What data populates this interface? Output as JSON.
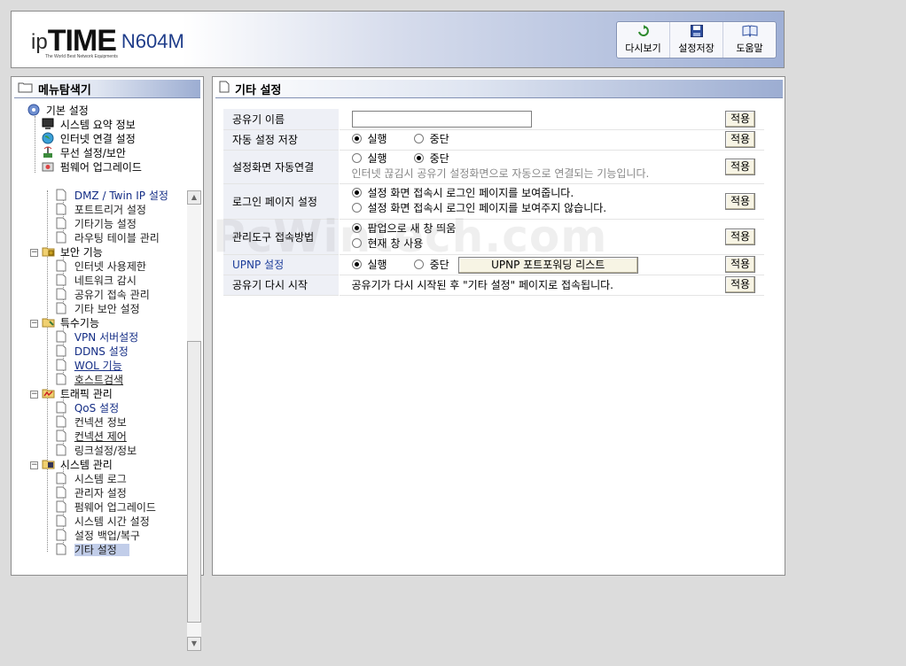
{
  "header": {
    "logo": {
      "prefix": "ip",
      "brand": "TIME",
      "model": "N604M",
      "tagline": "The World Best Network Equipments"
    },
    "toolbar": [
      {
        "label": "다시보기",
        "icon": "refresh-icon"
      },
      {
        "label": "설정저장",
        "icon": "save-icon"
      },
      {
        "label": "도움말",
        "icon": "help-book-icon"
      }
    ]
  },
  "sidebar": {
    "title": "메뉴탐색기",
    "tree": {
      "basic": {
        "label": "기본 설정",
        "items": [
          "시스템 요약 정보",
          "인터넷 연결 설정",
          "무선 설정/보안",
          "펌웨어 업그레이드"
        ]
      },
      "advanced_items": [
        "DMZ / Twin IP 설정",
        "포트트리거 설정",
        "기타기능 설정",
        "라우팅 테이블 관리"
      ],
      "security": {
        "label": "보안 기능",
        "items": [
          "인터넷 사용제한",
          "네트워크 감시",
          "공유기 접속 관리",
          "기타 보안 설정"
        ]
      },
      "special": {
        "label": "특수기능",
        "items": [
          "VPN 서버설정",
          "DDNS 설정",
          "WOL 기능",
          "호스트검색"
        ]
      },
      "traffic": {
        "label": "트래픽 관리",
        "items": [
          "QoS 설정",
          "컨넥션 정보",
          "컨넥션 제어",
          "링크설정/정보"
        ]
      },
      "system": {
        "label": "시스템 관리",
        "items": [
          "시스템 로그",
          "관리자 설정",
          "펌웨어 업그레이드",
          "시스템 시간 설정",
          "설정 백업/복구",
          "기타 설정"
        ]
      }
    }
  },
  "content": {
    "title": "기타 설정",
    "apply_label": "적용",
    "rows": {
      "name": {
        "label": "공유기 이름",
        "value": ""
      },
      "autosave": {
        "label": "자동 설정 저장",
        "opt_on": "실행",
        "opt_off": "중단",
        "selected": "on"
      },
      "autoconnect": {
        "label": "설정화면 자동연결",
        "opt_on": "실행",
        "opt_off": "중단",
        "selected": "off",
        "hint": "인터넷 끊김시 공유기 설정화면으로 자동으로 연결되는 기능입니다."
      },
      "login": {
        "label": "로그인 페이지 설정",
        "opt_show": "설정 화면 접속시 로그인 페이지를 보여줍니다.",
        "opt_hide": "설정 화면 접속시 로그인 페이지를 보여주지 않습니다.",
        "selected": "show"
      },
      "access": {
        "label": "관리도구 접속방법",
        "opt_popup": "팝업으로 새 창 띄움",
        "opt_current": "현재 창 사용",
        "selected": "popup"
      },
      "upnp": {
        "label": "UPNP 설정",
        "opt_on": "실행",
        "opt_off": "중단",
        "selected": "on",
        "list_button": "UPNP 포트포워딩 리스트"
      },
      "restart": {
        "label": "공유기 다시 시작",
        "text": "공유기가 다시 시작된 후 \"기타 설정\" 페이지로 접속됩니다."
      }
    }
  },
  "watermark": "PcWintech.com",
  "colors": {
    "header_gradient_end": "#9fb0d6",
    "label_bg": "#eef0f6",
    "button_bg": "#f7f4e4",
    "selected_bg": "#c1cde9",
    "link_blue": "#142d85"
  }
}
